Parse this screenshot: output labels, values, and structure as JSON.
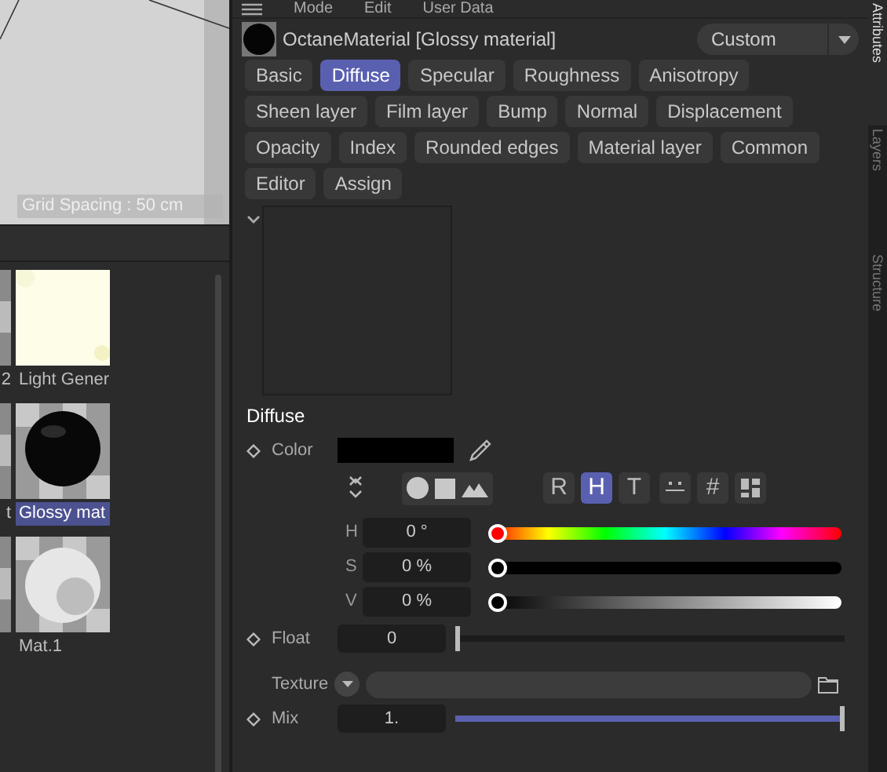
{
  "viewport": {
    "grid_label": "Grid Spacing : 50 cm"
  },
  "material_browser": {
    "cut_labels": [
      "2",
      "t"
    ],
    "items": [
      {
        "label": "Light Gener",
        "selected": false,
        "kind": "light"
      },
      {
        "label": "Glossy mat",
        "selected": true,
        "kind": "black"
      },
      {
        "label": "Mat.1",
        "selected": false,
        "kind": "white"
      }
    ]
  },
  "attributes": {
    "menu": [
      "Mode",
      "Edit",
      "User Data"
    ],
    "title": "OctaneMaterial [Glossy material]",
    "preset": "Custom",
    "tab_rows": [
      [
        {
          "label": "Basic",
          "selected": false
        },
        {
          "label": "Diffuse",
          "selected": true
        },
        {
          "label": "Specular",
          "selected": false
        },
        {
          "label": "Roughness",
          "selected": false
        },
        {
          "label": "Anisotropy",
          "selected": false
        }
      ],
      [
        {
          "label": "Sheen layer",
          "selected": false
        },
        {
          "label": "Film layer",
          "selected": false
        },
        {
          "label": "Bump",
          "selected": false
        },
        {
          "label": "Normal",
          "selected": false
        },
        {
          "label": "Displacement",
          "selected": false
        }
      ],
      [
        {
          "label": "Opacity",
          "selected": false
        },
        {
          "label": "Index",
          "selected": false
        },
        {
          "label": "Rounded edges",
          "selected": false
        },
        {
          "label": "Material layer",
          "selected": false
        },
        {
          "label": "Common",
          "selected": false
        }
      ],
      [
        {
          "label": "Editor",
          "selected": false
        },
        {
          "label": "Assign",
          "selected": false
        }
      ]
    ],
    "section": "Diffuse",
    "color": {
      "label": "Color",
      "color": "#000000"
    },
    "mode_buttons": [
      {
        "kind": "text",
        "label": "R",
        "selected": false
      },
      {
        "kind": "text",
        "label": "H",
        "selected": true
      },
      {
        "kind": "text",
        "label": "T",
        "selected": false
      },
      {
        "kind": "swatches",
        "selected": false
      },
      {
        "kind": "text",
        "label": "#",
        "selected": false
      },
      {
        "kind": "tiles",
        "selected": false
      }
    ],
    "hsv": [
      {
        "label": "H",
        "value": "0 °",
        "level": 0,
        "kind": "hue"
      },
      {
        "label": "S",
        "value": "0 %",
        "level": 0,
        "kind": "saturation"
      },
      {
        "label": "V",
        "value": "0 %",
        "level": 0,
        "kind": "value"
      }
    ],
    "float": {
      "label": "Float",
      "value": "0",
      "level": 0
    },
    "texture": {
      "label": "Texture"
    },
    "mix": {
      "label": "Mix",
      "value": "1.",
      "level": 1
    }
  },
  "side_tabs": [
    {
      "label": "Attributes",
      "selected": true
    },
    {
      "label": "Layers",
      "selected": false
    },
    {
      "label": "Structure",
      "selected": false
    }
  ]
}
